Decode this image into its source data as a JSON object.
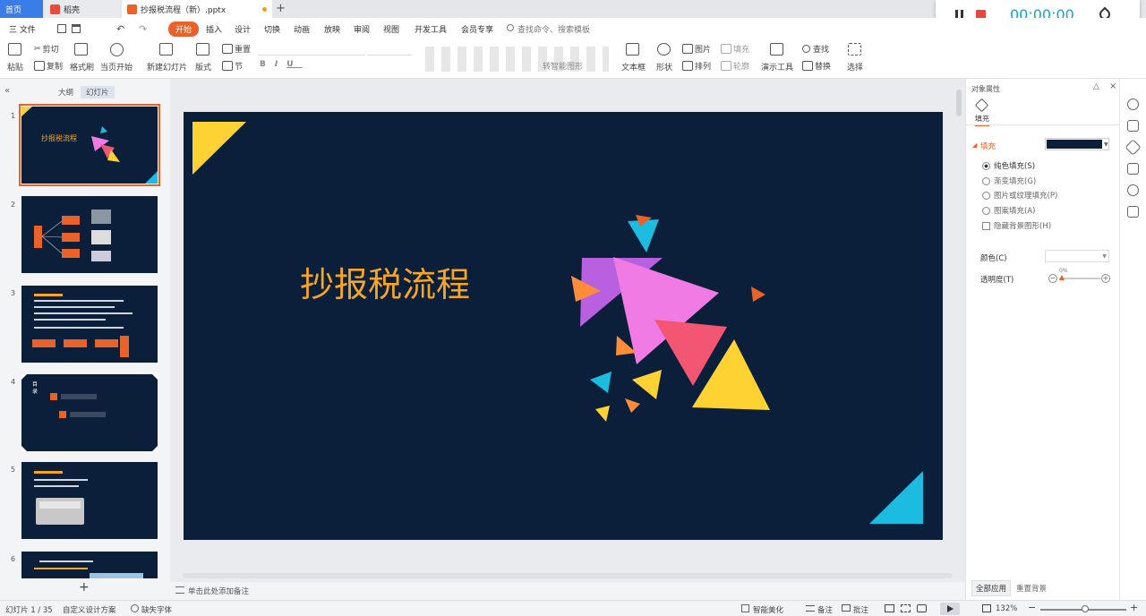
{
  "tabs": [
    {
      "label": "首页",
      "active": false
    },
    {
      "label": "稻壳",
      "active": false
    },
    {
      "label": "抄报税流程（新）.pptx",
      "active": true
    }
  ],
  "recorder": {
    "time": "00:00:00"
  },
  "menu": {
    "file": "三 文件",
    "items": [
      "开始",
      "插入",
      "设计",
      "切换",
      "动画",
      "放映",
      "审阅",
      "视图",
      "开发工具",
      "会员专享"
    ],
    "search": "查找命令、搜索模板"
  },
  "ribbon": {
    "paste": "粘贴",
    "cut": "剪切",
    "copy": "复制",
    "format_painter": "格式刷",
    "from_current": "当页开始",
    "new_slide": "新建幻灯片",
    "layout": "版式",
    "section": "节",
    "reset": "重置",
    "text_box": "文本框",
    "shape": "形状",
    "arrange": "排列",
    "picture": "图片",
    "fill": "填充",
    "outline": "轮廓",
    "presenter_tools": "演示工具",
    "replace": "替换",
    "find": "查找",
    "select": "选择",
    "convert_smartart": "转智能图形"
  },
  "left_panel": {
    "tab_outline": "大纲",
    "tab_slides": "幻灯片",
    "slide_numbers": [
      "1",
      "2",
      "3",
      "4",
      "5",
      "6"
    ],
    "add_label": "+"
  },
  "slide": {
    "title": "抄报税流程"
  },
  "thumb_text": {
    "s1_title": "抄报税流程",
    "s4_heading": "目录"
  },
  "notes_placeholder": "单击此处添加备注",
  "properties": {
    "title": "对象属性",
    "tab_fill": "填充",
    "section_fill": "填充",
    "options": [
      "纯色填充(S)",
      "渐变填充(G)",
      "图片或纹理填充(P)",
      "图案填充(A)"
    ],
    "hide_bg": "隐藏背景图形(H)",
    "color_label": "颜色(C)",
    "transparency_label": "透明度(T)",
    "transparency_value": "0%",
    "apply_all": "全部应用",
    "reset_bg": "重置背景"
  },
  "status": {
    "slide_info": "幻灯片 1 / 35",
    "theme": "自定义设计方案",
    "missing_font": "缺失字体",
    "beautify": "智能美化",
    "notes": "备注",
    "comments": "批注",
    "zoom": "132%"
  },
  "colors": {
    "slide_bg": "#0b1f3a",
    "title": "#f5a623",
    "accent": "#e8622a",
    "timer": "#0aa6d8",
    "yellow": "#ffd234",
    "cyan": "#1cbce0",
    "pink": "#f07be5",
    "purple": "#b860e0",
    "red": "#f25672",
    "orange": "#ff8c3b"
  }
}
